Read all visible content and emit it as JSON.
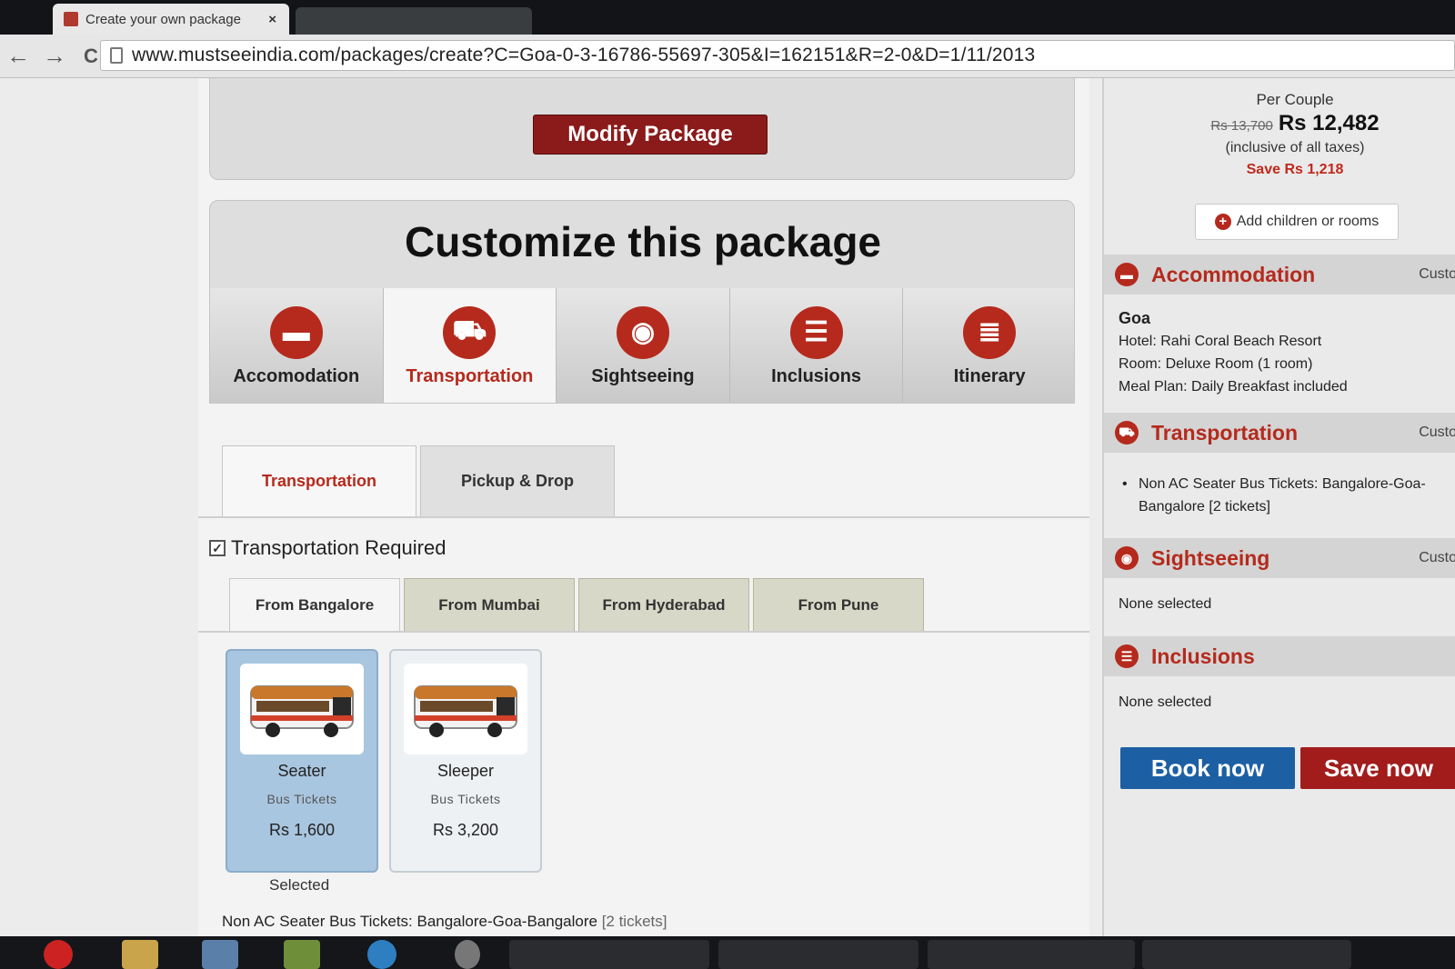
{
  "browser": {
    "tab_title": "Create your own package",
    "tab_close": "×",
    "back": "←",
    "forward": "→",
    "reload": "C",
    "url": "www.mustseeindia.com/packages/create?C=Goa-0-3-16786-55697-305&I=162151&R=2-0&D=1/11/2013"
  },
  "main": {
    "modify_label": "Modify Package",
    "heading": "Customize this package",
    "categories": [
      {
        "label": "Accomodation",
        "icon": "bed-icon",
        "glyph": "▬"
      },
      {
        "label": "Transportation",
        "icon": "car-icon",
        "glyph": "⛟"
      },
      {
        "label": "Sightseeing",
        "icon": "eye-icon",
        "glyph": "◉"
      },
      {
        "label": "Inclusions",
        "icon": "list-icon",
        "glyph": "☰"
      },
      {
        "label": "Itinerary",
        "icon": "document-icon",
        "glyph": "≣"
      }
    ],
    "subtabs": [
      "Transportation",
      "Pickup & Drop"
    ],
    "checkbox_mark": "✓",
    "required_label": "Transportation Required",
    "cities": [
      "From Bangalore",
      "From Mumbai",
      "From Hyderabad",
      "From Pune"
    ],
    "options": [
      {
        "name": "Seater",
        "sub": "Bus Tickets",
        "price": "Rs 1,600"
      },
      {
        "name": "Sleeper",
        "sub": "Bus Tickets",
        "price": "Rs 3,200"
      }
    ],
    "selected_label": "Selected",
    "summary": "Non AC Seater Bus Tickets: Bangalore-Goa-Bangalore",
    "summary_count": "[2 tickets]"
  },
  "sidebar": {
    "per_label": "Per Couple",
    "old_price": "Rs 13,700",
    "price": "Rs 12,482",
    "taxes_note": "(inclusive of all taxes)",
    "save_note": "Save Rs 1,218",
    "add_label": "Add children or rooms",
    "add_glyph": "+",
    "custom_label": "Custo",
    "accommodation": {
      "title": "Accommodation",
      "city": "Goa",
      "hotel": "Hotel: Rahi Coral Beach Resort",
      "room": "Room: Deluxe Room  (1 room)",
      "meal": "Meal Plan: Daily Breakfast included"
    },
    "transportation": {
      "title": "Transportation",
      "item": "Non AC Seater Bus Tickets: Bangalore-Goa-Bangalore [2 tickets]"
    },
    "sightseeing": {
      "title": "Sightseeing",
      "value": "None selected"
    },
    "inclusions": {
      "title": "Inclusions",
      "value": "None selected"
    },
    "book_label": "Book now",
    "save_label": "Save now"
  },
  "colors": {
    "accent": "#b52a1d",
    "book": "#1d5fa3",
    "save": "#a21c1c",
    "selected_card": "#a9c6e0"
  }
}
